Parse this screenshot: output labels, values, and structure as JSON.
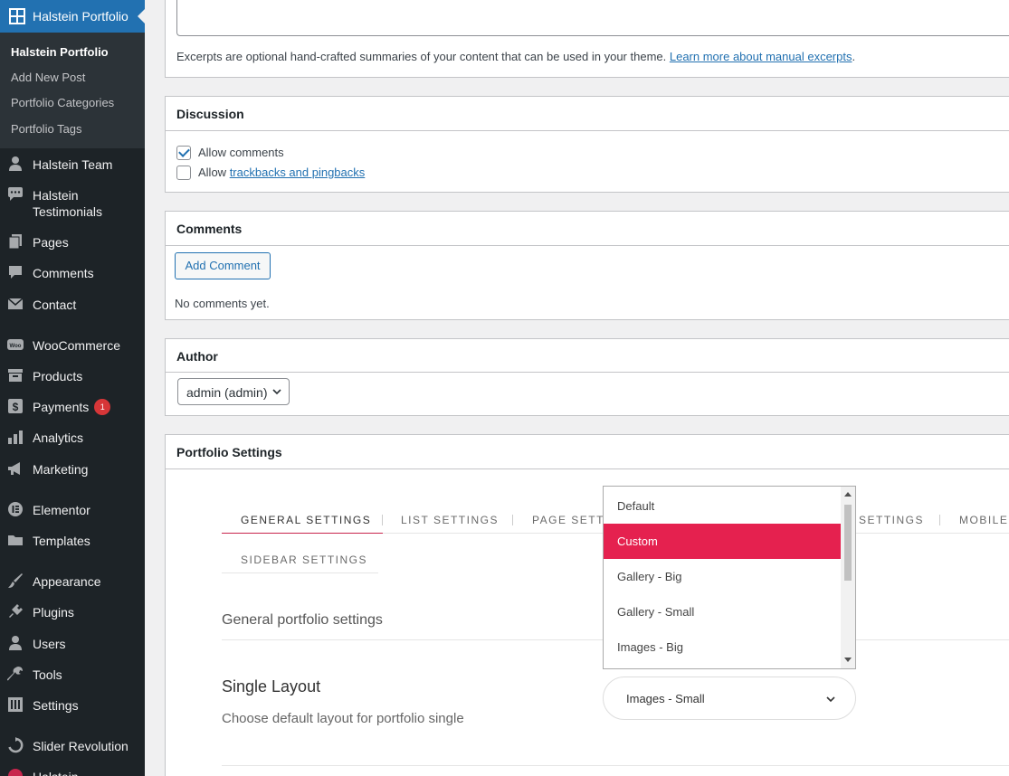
{
  "sidebar": {
    "current_menu": {
      "label": "Halstein Portfolio",
      "icon": "grid-icon"
    },
    "submenu": [
      "Halstein Portfolio",
      "Add New Post",
      "Portfolio Categories",
      "Portfolio Tags"
    ],
    "items": [
      {
        "label": "Halstein Team",
        "icon": "person-icon"
      },
      {
        "label_line1": "Halstein",
        "label_line2": "Testimonials",
        "icon": "speech-bubble-icon"
      },
      {
        "label": "Pages",
        "icon": "pages-icon"
      },
      {
        "label": "Comments",
        "icon": "comment-icon"
      },
      {
        "label": "Contact",
        "icon": "envelope-icon"
      },
      {
        "label": "WooCommerce",
        "icon": "woo-icon"
      },
      {
        "label": "Products",
        "icon": "archive-icon"
      },
      {
        "label": "Payments",
        "icon": "dollar-icon",
        "badge": "1"
      },
      {
        "label": "Analytics",
        "icon": "bar-chart-icon"
      },
      {
        "label": "Marketing",
        "icon": "megaphone-icon"
      },
      {
        "label": "Elementor",
        "icon": "elementor-icon"
      },
      {
        "label": "Templates",
        "icon": "folder-icon"
      },
      {
        "label": "Appearance",
        "icon": "brush-icon"
      },
      {
        "label": "Plugins",
        "icon": "plug-icon"
      },
      {
        "label": "Users",
        "icon": "users-icon"
      },
      {
        "label": "Tools",
        "icon": "wrench-icon"
      },
      {
        "label": "Settings",
        "icon": "sliders-icon"
      },
      {
        "label": "Slider Revolution",
        "icon": "refresh-icon"
      },
      {
        "label": "Halstein",
        "icon": "circle-icon"
      }
    ]
  },
  "excerpt": {
    "help_text": "Excerpts are optional hand-crafted summaries of your content that can be used in your theme. ",
    "help_link": "Learn more about manual excerpts",
    "help_end": "."
  },
  "discussion": {
    "title": "Discussion",
    "allow_comments": "Allow comments",
    "allow_prefix": "Allow ",
    "trackbacks_link": "trackbacks and pingbacks"
  },
  "comments": {
    "title": "Comments",
    "add_button": "Add Comment",
    "empty_text": "No comments yet."
  },
  "author": {
    "title": "Author",
    "selected": "admin (admin)"
  },
  "portfolio": {
    "title": "Portfolio Settings",
    "tabs": [
      "GENERAL SETTINGS",
      "LIST SETTINGS",
      "PAGE SETTI",
      "SETTINGS",
      "MOBILE",
      "SIDEBAR SETTINGS"
    ],
    "section_title": "General portfolio settings",
    "field_label": "Single Layout",
    "field_desc": "Choose default layout for portfolio single",
    "dropdown_options": [
      "Default",
      "Custom",
      "Gallery - Big",
      "Gallery - Small",
      "Images - Big"
    ],
    "dropdown_highlighted": "Custom",
    "selected_value": "Images - Small"
  },
  "colors": {
    "admin_blue": "#2271b1",
    "sidebar_bg": "#1d2327",
    "accent_red": "#e5214f",
    "badge_red": "#d63638"
  }
}
